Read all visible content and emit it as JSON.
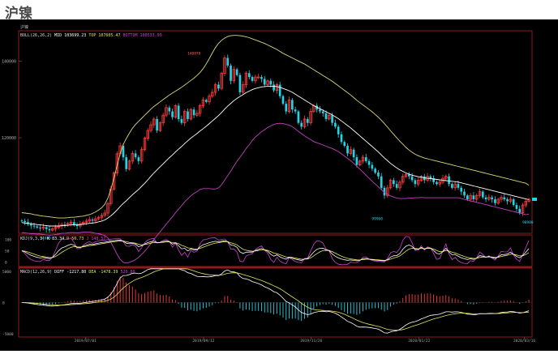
{
  "page": {
    "title": "沪镍"
  },
  "chart_data": {
    "type": "candlestick",
    "main": {
      "header_symbol": "沪镍",
      "boll": {
        "label": "BOLL(26,26,2)",
        "mid_label": "MID",
        "mid": "103699.23",
        "top_label": "TOP",
        "top": "107605.47",
        "bottom_label": "BOTTOM",
        "bottom": "100533.99"
      },
      "y_ticks": [
        140000,
        120000
      ],
      "ylim": [
        95000,
        148000
      ],
      "annotations": [
        {
          "label": "140870",
          "x": 70,
          "y": 140870
        },
        {
          "label": "99960",
          "x": 146,
          "y": 99960
        },
        {
          "label": "98980",
          "x": 208,
          "y": 98980
        },
        {
          "label": "94880",
          "x": 10,
          "y": 94880
        }
      ],
      "close": [
        98200,
        97900,
        97400,
        97000,
        96800,
        96500,
        96300,
        96600,
        96100,
        95800,
        96200,
        96600,
        96900,
        97300,
        97100,
        97600,
        97900,
        97300,
        96900,
        97500,
        97900,
        98200,
        98600,
        98300,
        98800,
        99200,
        99700,
        100300,
        102800,
        106600,
        110800,
        115800,
        117900,
        114900,
        111800,
        113900,
        115900,
        114900,
        113900,
        116900,
        119900,
        121900,
        123400,
        124900,
        121900,
        123900,
        125900,
        127900,
        126900,
        125400,
        128400,
        124900,
        123900,
        126900,
        124900,
        127400,
        125900,
        126400,
        128400,
        129900,
        129400,
        130900,
        131900,
        133900,
        132900,
        136900,
        140900,
        138900,
        134900,
        137900,
        136400,
        131900,
        133900,
        136900,
        135900,
        134900,
        135900,
        135900,
        135400,
        133900,
        134900,
        133900,
        132400,
        133900,
        130900,
        128900,
        126900,
        129900,
        127400,
        126900,
        123900,
        122900,
        124900,
        123900,
        126900,
        128400,
        127400,
        126900,
        126400,
        124900,
        125900,
        123900,
        122900,
        120900,
        118900,
        117900,
        115900,
        116900,
        114900,
        112900,
        113900,
        114900,
        113900,
        112900,
        111900,
        110900,
        109900,
        106900,
        104900,
        106900,
        108900,
        107900,
        106900,
        108400,
        109900,
        110400,
        109900,
        108900,
        107900,
        108900,
        109900,
        108900,
        109900,
        109400,
        108400,
        107900,
        108400,
        109400,
        109900,
        107900,
        106900,
        107900,
        106900,
        105900,
        104900,
        103900,
        104900,
        103900,
        104900,
        105900,
        104400,
        103900,
        104400,
        103900,
        102900,
        103900,
        104400,
        103900,
        103400,
        103900,
        102400,
        101400,
        100400,
        102400,
        103400,
        103900
      ],
      "boll_mid": [
        97800,
        97700,
        97600,
        97500,
        97400,
        97300,
        97200,
        97100,
        97000,
        96900,
        96900,
        96900,
        96900,
        97000,
        97000,
        97100,
        97200,
        97200,
        97200,
        97300,
        97400,
        97500,
        97600,
        97700,
        97800,
        98000,
        98200,
        98500,
        99000,
        99600,
        100300,
        101100,
        102000,
        102800,
        103500,
        104300,
        105100,
        105800,
        106500,
        107300,
        108100,
        109000,
        109900,
        110800,
        111600,
        112400,
        113200,
        114000,
        114800,
        115500,
        116300,
        117000,
        117700,
        118500,
        119200,
        119900,
        120500,
        121100,
        121800,
        122400,
        123000,
        123700,
        124400,
        125100,
        125800,
        126600,
        127500,
        128300,
        129000,
        129700,
        130300,
        130800,
        131300,
        131800,
        132200,
        132600,
        132900,
        133100,
        133300,
        133400,
        133500,
        133500,
        133500,
        133400,
        133200,
        132900,
        132600,
        132300,
        131900,
        131400,
        130900,
        130400,
        129900,
        129400,
        128900,
        128400,
        128000,
        127600,
        127200,
        126800,
        126400,
        126000,
        125500,
        125000,
        124400,
        123800,
        123200,
        122600,
        121900,
        121200,
        120500,
        119800,
        119100,
        118400,
        117700,
        117000,
        116300,
        115500,
        114700,
        114000,
        113300,
        112700,
        112100,
        111600,
        111200,
        110800,
        110500,
        110200,
        110000,
        109800,
        109700,
        109500,
        109400,
        109300,
        109200,
        109100,
        109000,
        108900,
        108800,
        108700,
        108600,
        108500,
        108400,
        108200,
        108000,
        107800,
        107600,
        107400,
        107200,
        107000,
        106800,
        106600,
        106400,
        106200,
        106000,
        105800,
        105600,
        105400,
        105200,
        105000,
        104800,
        104600,
        104400,
        104200,
        104000,
        103800
      ],
      "boll_top": [
        100400,
        100300,
        100200,
        100100,
        99900,
        99800,
        99600,
        99500,
        99400,
        99300,
        99200,
        99100,
        99000,
        99000,
        99000,
        99100,
        99200,
        99200,
        99300,
        99400,
        99500,
        99700,
        99900,
        100200,
        100600,
        101100,
        101700,
        102600,
        104200,
        106600,
        109500,
        112700,
        115800,
        118200,
        119800,
        121200,
        122500,
        123500,
        124300,
        125100,
        125900,
        126700,
        127500,
        128200,
        128800,
        129400,
        130000,
        130600,
        131200,
        131700,
        132200,
        132700,
        133200,
        133800,
        134400,
        135000,
        135600,
        136300,
        137100,
        138100,
        139300,
        140700,
        142200,
        143600,
        144700,
        145500,
        146100,
        146500,
        146700,
        146800,
        146800,
        146700,
        146600,
        146400,
        146200,
        145900,
        145600,
        145300,
        145000,
        144700,
        144300,
        143900,
        143500,
        143100,
        142600,
        142100,
        141700,
        141300,
        140900,
        140500,
        140100,
        139700,
        139300,
        138800,
        138300,
        137800,
        137300,
        136800,
        136300,
        135800,
        135300,
        134800,
        134200,
        133600,
        133000,
        132400,
        131800,
        131200,
        130500,
        129800,
        129200,
        128600,
        128000,
        127400,
        126800,
        126100,
        125400,
        124600,
        123700,
        122800,
        121800,
        120900,
        120000,
        119100,
        118300,
        117500,
        116800,
        116200,
        115700,
        115300,
        115000,
        114700,
        114500,
        114300,
        114100,
        113900,
        113700,
        113500,
        113300,
        113100,
        112900,
        112700,
        112500,
        112300,
        112100,
        111900,
        111700,
        111500,
        111300,
        111100,
        110900,
        110700,
        110500,
        110300,
        110100,
        109900,
        109700,
        109500,
        109300,
        109100,
        108900,
        108700,
        108500,
        108300,
        108100,
        107600
      ],
      "boll_bottom": [
        95200,
        95100,
        95000,
        94900,
        94900,
        94800,
        94800,
        94700,
        94600,
        94500,
        94600,
        94700,
        94800,
        95000,
        95000,
        95100,
        95200,
        95200,
        95100,
        95200,
        95300,
        95300,
        95300,
        95200,
        95000,
        94900,
        94700,
        94400,
        93800,
        92600,
        91100,
        89500,
        88200,
        87400,
        87200,
        87400,
        87700,
        88100,
        88700,
        89500,
        90300,
        91300,
        92300,
        93400,
        94400,
        95400,
        96400,
        97400,
        98400,
        99300,
        100400,
        101300,
        102200,
        103200,
        104000,
        104800,
        105400,
        105900,
        106500,
        106700,
        106700,
        106700,
        106600,
        106600,
        106900,
        107700,
        108900,
        110100,
        111300,
        112600,
        113800,
        114900,
        116000,
        117200,
        118200,
        119300,
        120200,
        120900,
        121600,
        122100,
        122700,
        123100,
        123500,
        123700,
        123800,
        123700,
        123500,
        123300,
        122900,
        122300,
        121700,
        121100,
        120500,
        120000,
        119500,
        119000,
        118700,
        118400,
        118100,
        117800,
        117500,
        117200,
        116800,
        116400,
        115800,
        115200,
        114600,
        114000,
        113300,
        112600,
        111800,
        111000,
        110200,
        109400,
        108600,
        107900,
        107200,
        106400,
        105700,
        105200,
        104800,
        104500,
        104200,
        104100,
        104100,
        104100,
        104200,
        104200,
        104300,
        104300,
        104400,
        104300,
        104300,
        104300,
        104300,
        104300,
        104300,
        104300,
        104300,
        104300,
        104300,
        104300,
        104300,
        104100,
        103900,
        103700,
        103500,
        103300,
        103100,
        102900,
        102700,
        102500,
        102300,
        102100,
        101900,
        101700,
        101500,
        101300,
        101100,
        100900,
        100700,
        100500,
        100300,
        100100,
        99900,
        100000
      ]
    },
    "kdj": {
      "label": "KDJ(9,3,3)",
      "k_label": "K",
      "k": "83.34",
      "d_label": "D",
      "d": "50.73",
      "j_label": "J",
      "j": "148.57",
      "y_ticks": [
        100,
        50,
        0
      ],
      "ylim": [
        -20,
        120
      ]
    },
    "macd": {
      "label": "MACD(12,26,9)",
      "diff_label": "DIFF",
      "diff": "-1217.80",
      "dea_label": "DEA",
      "dea": "-1478.39",
      "macd_value": "520.80",
      "y_ticks": [
        5000,
        0,
        -5000
      ],
      "ylim": [
        -5500,
        5500
      ]
    },
    "x_labels": [
      "2019/07/01",
      "2019/09/12",
      "2019/11/26",
      "2020/01/22",
      "2020/03/16"
    ],
    "colors": {
      "up": "#ff3c3c",
      "down": "#22d4e6",
      "mid": "#ffffff",
      "top": "#d8d878",
      "bottom": "#c040c0",
      "k": "#ffffff",
      "d": "#e6e65a",
      "j": "#d040d0",
      "frame": "#8b1c1c"
    }
  }
}
